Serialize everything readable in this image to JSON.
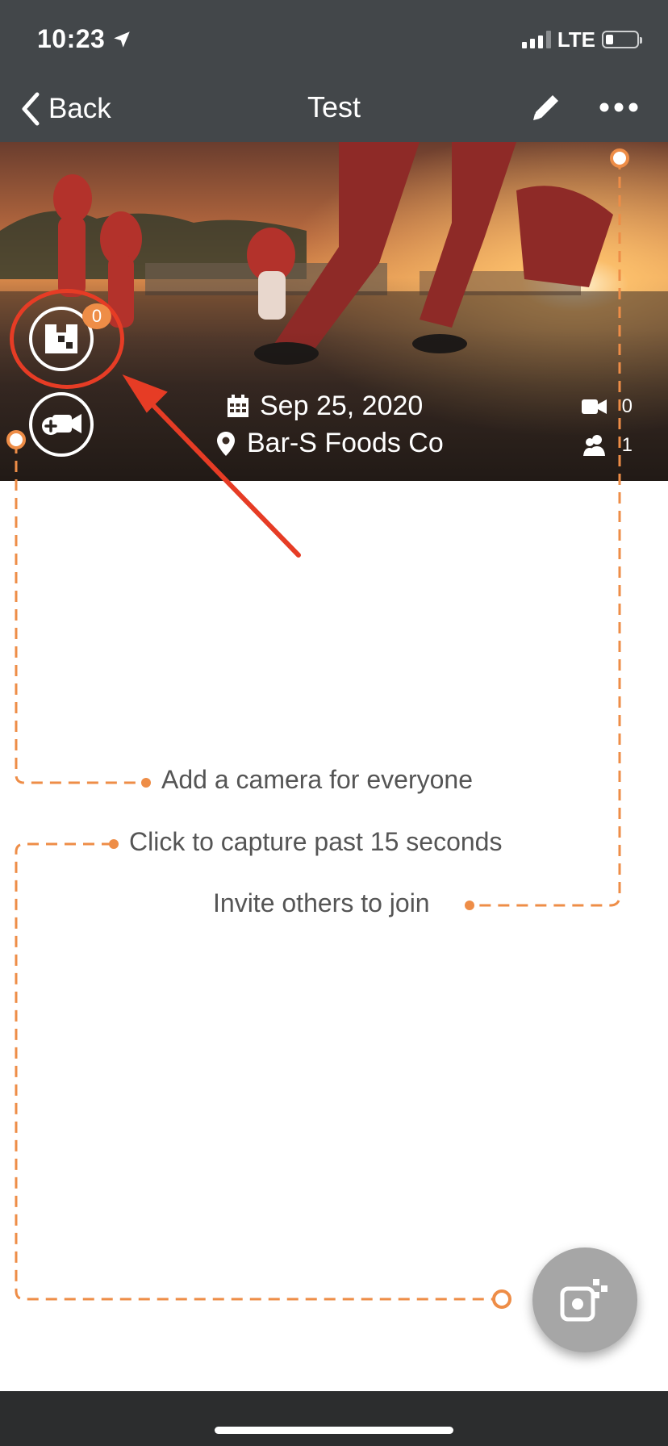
{
  "status_bar": {
    "time": "10:23",
    "network": "LTE",
    "icons": [
      "location-arrow-icon",
      "signal-icon",
      "battery-icon"
    ]
  },
  "nav": {
    "back_label": "Back",
    "title": "Test",
    "icons": [
      "chevron-left-icon",
      "pencil-icon",
      "more-icon"
    ]
  },
  "event": {
    "date": "Sep 25, 2020",
    "location": "Bar-S Foods Co",
    "camera_count": "0",
    "people_count": "1",
    "capture_badge": "0"
  },
  "tips": {
    "add_camera": "Add a camera for everyone",
    "capture_past": "Click to capture past 15 seconds",
    "invite": "Invite others to join"
  },
  "colors": {
    "bar_background": "#43474a",
    "accent_orange": "#ee8d47",
    "highlight_red": "#e63c25",
    "tip_text": "#555555",
    "fab_background": "#a6a6a6"
  }
}
